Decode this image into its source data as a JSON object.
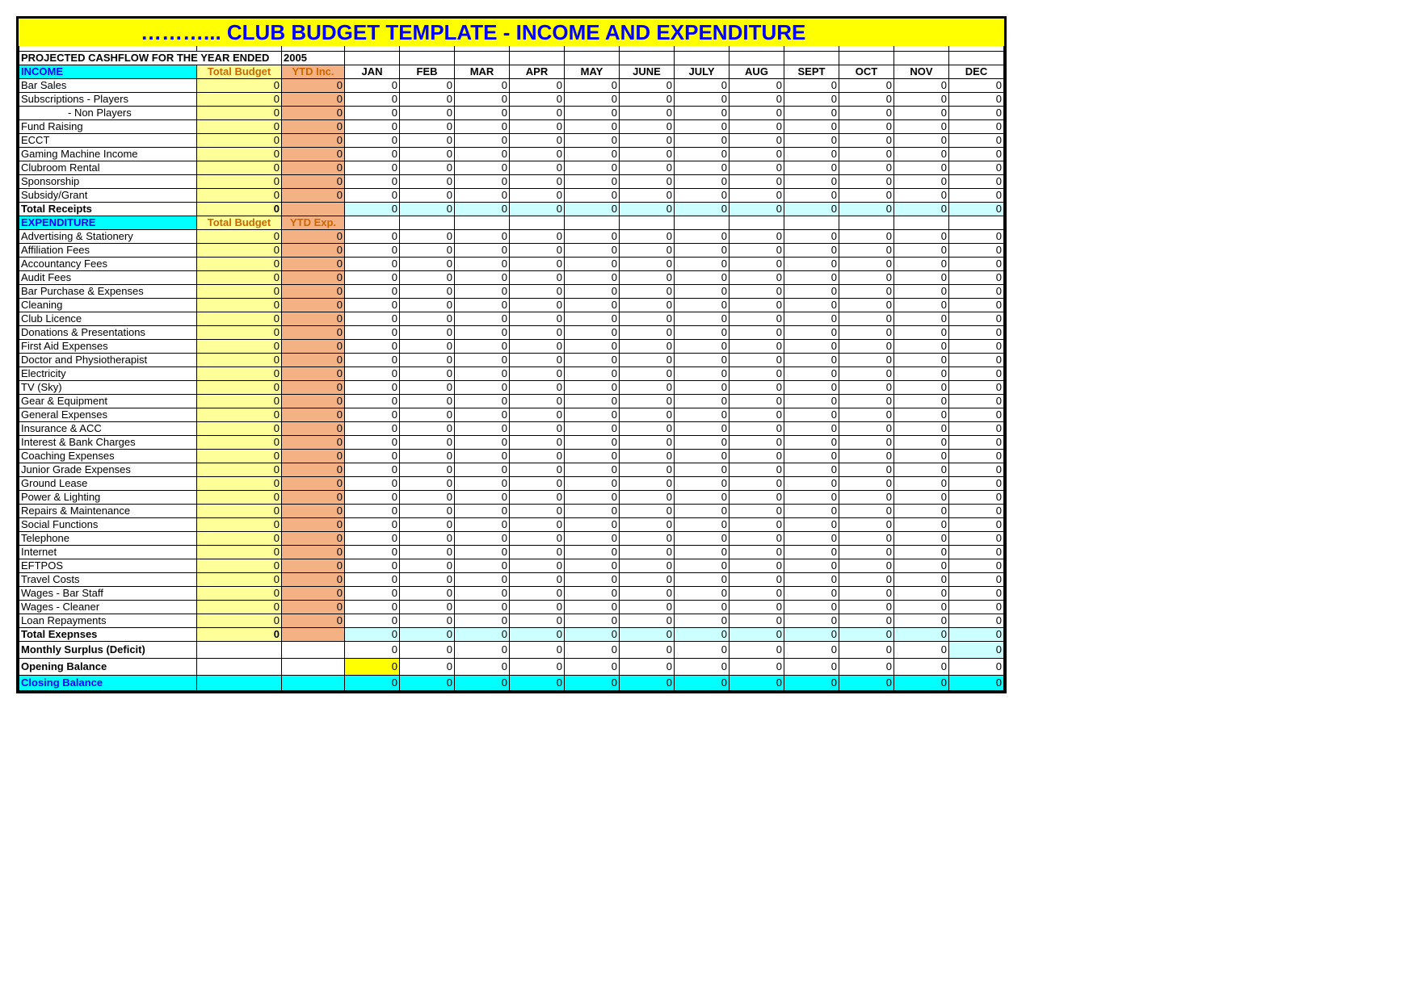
{
  "title": "………...  CLUB BUDGET TEMPLATE - INCOME AND EXPENDITURE",
  "projected_label": "PROJECTED CASHFLOW FOR THE YEAR ENDED",
  "projected_year": "2005",
  "months": [
    "JAN",
    "FEB",
    "MAR",
    "APR",
    "MAY",
    "JUNE",
    "JULY",
    "AUG",
    "SEPT",
    "OCT",
    "NOV",
    "DEC"
  ],
  "income": {
    "header": {
      "label": "INCOME",
      "total_budget": "Total Budget",
      "ytd": "YTD Inc."
    },
    "rows": [
      {
        "label": "Bar Sales",
        "tb": "0",
        "ytd": "0",
        "m": [
          "0",
          "0",
          "0",
          "0",
          "0",
          "0",
          "0",
          "0",
          "0",
          "0",
          "0",
          "0"
        ]
      },
      {
        "label": "Subscriptions - Players",
        "tb": "0",
        "ytd": "0",
        "m": [
          "0",
          "0",
          "0",
          "0",
          "0",
          "0",
          "0",
          "0",
          "0",
          "0",
          "0",
          "0"
        ]
      },
      {
        "label": "- Non Players",
        "indent": true,
        "tb": "0",
        "ytd": "0",
        "m": [
          "0",
          "0",
          "0",
          "0",
          "0",
          "0",
          "0",
          "0",
          "0",
          "0",
          "0",
          "0"
        ]
      },
      {
        "label": "Fund Raising",
        "tb": "0",
        "ytd": "0",
        "m": [
          "0",
          "0",
          "0",
          "0",
          "0",
          "0",
          "0",
          "0",
          "0",
          "0",
          "0",
          "0"
        ]
      },
      {
        "label": "ECCT",
        "tb": "0",
        "ytd": "0",
        "m": [
          "0",
          "0",
          "0",
          "0",
          "0",
          "0",
          "0",
          "0",
          "0",
          "0",
          "0",
          "0"
        ]
      },
      {
        "label": "Gaming Machine Income",
        "tb": "0",
        "ytd": "0",
        "m": [
          "0",
          "0",
          "0",
          "0",
          "0",
          "0",
          "0",
          "0",
          "0",
          "0",
          "0",
          "0"
        ]
      },
      {
        "label": "Clubroom Rental",
        "tb": "0",
        "ytd": "0",
        "m": [
          "0",
          "0",
          "0",
          "0",
          "0",
          "0",
          "0",
          "0",
          "0",
          "0",
          "0",
          "0"
        ]
      },
      {
        "label": "Sponsorship",
        "tb": "0",
        "ytd": "0",
        "m": [
          "0",
          "0",
          "0",
          "0",
          "0",
          "0",
          "0",
          "0",
          "0",
          "0",
          "0",
          "0"
        ]
      },
      {
        "label": "Subsidy/Grant",
        "tb": "0",
        "ytd": "0",
        "m": [
          "0",
          "0",
          "0",
          "0",
          "0",
          "0",
          "0",
          "0",
          "0",
          "0",
          "0",
          "0"
        ]
      }
    ],
    "total": {
      "label": "Total Receipts",
      "tb": "0",
      "ytd": "",
      "m": [
        "0",
        "0",
        "0",
        "0",
        "0",
        "0",
        "0",
        "0",
        "0",
        "0",
        "0",
        "0"
      ]
    }
  },
  "expenditure": {
    "header": {
      "label": "EXPENDITURE",
      "total_budget": "Total Budget",
      "ytd": "YTD Exp."
    },
    "rows": [
      {
        "label": "Advertising & Stationery",
        "tb": "0",
        "ytd": "0",
        "m": [
          "0",
          "0",
          "0",
          "0",
          "0",
          "0",
          "0",
          "0",
          "0",
          "0",
          "0",
          "0"
        ]
      },
      {
        "label": "Affiliation Fees",
        "tb": "0",
        "ytd": "0",
        "m": [
          "0",
          "0",
          "0",
          "0",
          "0",
          "0",
          "0",
          "0",
          "0",
          "0",
          "0",
          "0"
        ]
      },
      {
        "label": "Accountancy Fees",
        "tb": "0",
        "ytd": "0",
        "m": [
          "0",
          "0",
          "0",
          "0",
          "0",
          "0",
          "0",
          "0",
          "0",
          "0",
          "0",
          "0"
        ]
      },
      {
        "label": "Audit Fees",
        "tb": "0",
        "ytd": "0",
        "m": [
          "0",
          "0",
          "0",
          "0",
          "0",
          "0",
          "0",
          "0",
          "0",
          "0",
          "0",
          "0"
        ]
      },
      {
        "label": "Bar Purchase & Expenses",
        "tb": "0",
        "ytd": "0",
        "m": [
          "0",
          "0",
          "0",
          "0",
          "0",
          "0",
          "0",
          "0",
          "0",
          "0",
          "0",
          "0"
        ]
      },
      {
        "label": "Cleaning",
        "tb": "0",
        "ytd": "0",
        "m": [
          "0",
          "0",
          "0",
          "0",
          "0",
          "0",
          "0",
          "0",
          "0",
          "0",
          "0",
          "0"
        ]
      },
      {
        "label": "Club Licence",
        "tb": "0",
        "ytd": "0",
        "m": [
          "0",
          "0",
          "0",
          "0",
          "0",
          "0",
          "0",
          "0",
          "0",
          "0",
          "0",
          "0"
        ]
      },
      {
        "label": "Donations & Presentations",
        "tb": "0",
        "ytd": "0",
        "m": [
          "0",
          "0",
          "0",
          "0",
          "0",
          "0",
          "0",
          "0",
          "0",
          "0",
          "0",
          "0"
        ]
      },
      {
        "label": "First Aid Expenses",
        "tb": "0",
        "ytd": "0",
        "m": [
          "0",
          "0",
          "0",
          "0",
          "0",
          "0",
          "0",
          "0",
          "0",
          "0",
          "0",
          "0"
        ]
      },
      {
        "label": "Doctor and Physiotherapist",
        "tb": "0",
        "ytd": "0",
        "m": [
          "0",
          "0",
          "0",
          "0",
          "0",
          "0",
          "0",
          "0",
          "0",
          "0",
          "0",
          "0"
        ]
      },
      {
        "label": "Electricity",
        "tb": "0",
        "ytd": "0",
        "m": [
          "0",
          "0",
          "0",
          "0",
          "0",
          "0",
          "0",
          "0",
          "0",
          "0",
          "0",
          "0"
        ]
      },
      {
        "label": "TV (Sky)",
        "tb": "0",
        "ytd": "0",
        "m": [
          "0",
          "0",
          "0",
          "0",
          "0",
          "0",
          "0",
          "0",
          "0",
          "0",
          "0",
          "0"
        ]
      },
      {
        "label": "Gear & Equipment",
        "tb": "0",
        "ytd": "0",
        "m": [
          "0",
          "0",
          "0",
          "0",
          "0",
          "0",
          "0",
          "0",
          "0",
          "0",
          "0",
          "0"
        ]
      },
      {
        "label": "General Expenses",
        "tb": "0",
        "ytd": "0",
        "m": [
          "0",
          "0",
          "0",
          "0",
          "0",
          "0",
          "0",
          "0",
          "0",
          "0",
          "0",
          "0"
        ]
      },
      {
        "label": "Insurance & ACC",
        "tb": "0",
        "ytd": "0",
        "m": [
          "0",
          "0",
          "0",
          "0",
          "0",
          "0",
          "0",
          "0",
          "0",
          "0",
          "0",
          "0"
        ]
      },
      {
        "label": "Interest & Bank Charges",
        "tb": "0",
        "ytd": "0",
        "m": [
          "0",
          "0",
          "0",
          "0",
          "0",
          "0",
          "0",
          "0",
          "0",
          "0",
          "0",
          "0"
        ]
      },
      {
        "label": "Coaching Expenses",
        "tb": "0",
        "ytd": "0",
        "m": [
          "0",
          "0",
          "0",
          "0",
          "0",
          "0",
          "0",
          "0",
          "0",
          "0",
          "0",
          "0"
        ]
      },
      {
        "label": "Junior Grade Expenses",
        "tb": "0",
        "ytd": "0",
        "m": [
          "0",
          "0",
          "0",
          "0",
          "0",
          "0",
          "0",
          "0",
          "0",
          "0",
          "0",
          "0"
        ]
      },
      {
        "label": "Ground Lease",
        "tb": "0",
        "ytd": "0",
        "m": [
          "0",
          "0",
          "0",
          "0",
          "0",
          "0",
          "0",
          "0",
          "0",
          "0",
          "0",
          "0"
        ]
      },
      {
        "label": "Power & Lighting",
        "tb": "0",
        "ytd": "0",
        "m": [
          "0",
          "0",
          "0",
          "0",
          "0",
          "0",
          "0",
          "0",
          "0",
          "0",
          "0",
          "0"
        ]
      },
      {
        "label": "Repairs & Maintenance",
        "tb": "0",
        "ytd": "0",
        "m": [
          "0",
          "0",
          "0",
          "0",
          "0",
          "0",
          "0",
          "0",
          "0",
          "0",
          "0",
          "0"
        ]
      },
      {
        "label": "Social Functions",
        "tb": "0",
        "ytd": "0",
        "m": [
          "0",
          "0",
          "0",
          "0",
          "0",
          "0",
          "0",
          "0",
          "0",
          "0",
          "0",
          "0"
        ]
      },
      {
        "label": "Telephone",
        "tb": "0",
        "ytd": "0",
        "m": [
          "0",
          "0",
          "0",
          "0",
          "0",
          "0",
          "0",
          "0",
          "0",
          "0",
          "0",
          "0"
        ]
      },
      {
        "label": "Internet",
        "tb": "0",
        "ytd": "0",
        "m": [
          "0",
          "0",
          "0",
          "0",
          "0",
          "0",
          "0",
          "0",
          "0",
          "0",
          "0",
          "0"
        ]
      },
      {
        "label": "EFTPOS",
        "tb": "0",
        "ytd": "0",
        "m": [
          "0",
          "0",
          "0",
          "0",
          "0",
          "0",
          "0",
          "0",
          "0",
          "0",
          "0",
          "0"
        ]
      },
      {
        "label": "Travel Costs",
        "tb": "0",
        "ytd": "0",
        "m": [
          "0",
          "0",
          "0",
          "0",
          "0",
          "0",
          "0",
          "0",
          "0",
          "0",
          "0",
          "0"
        ]
      },
      {
        "label": "Wages - Bar Staff",
        "tb": "0",
        "ytd": "0",
        "m": [
          "0",
          "0",
          "0",
          "0",
          "0",
          "0",
          "0",
          "0",
          "0",
          "0",
          "0",
          "0"
        ]
      },
      {
        "label": "Wages - Cleaner",
        "tb": "0",
        "ytd": "0",
        "m": [
          "0",
          "0",
          "0",
          "0",
          "0",
          "0",
          "0",
          "0",
          "0",
          "0",
          "0",
          "0"
        ]
      },
      {
        "label": "Loan Repayments",
        "tb": "0",
        "ytd": "0",
        "m": [
          "0",
          "0",
          "0",
          "0",
          "0",
          "0",
          "0",
          "0",
          "0",
          "0",
          "0",
          "0"
        ]
      }
    ],
    "total": {
      "label": "Total  Exepnses",
      "tb": "0",
      "ytd": "",
      "m": [
        "0",
        "0",
        "0",
        "0",
        "0",
        "0",
        "0",
        "0",
        "0",
        "0",
        "0",
        "0"
      ]
    }
  },
  "surplus": {
    "label": "Monthly Surplus (Deficit)",
    "m": [
      "0",
      "0",
      "0",
      "0",
      "0",
      "0",
      "0",
      "0",
      "0",
      "0",
      "0",
      "0"
    ]
  },
  "opening": {
    "label": "Opening Balance",
    "m": [
      "0",
      "0",
      "0",
      "0",
      "0",
      "0",
      "0",
      "0",
      "0",
      "0",
      "0",
      "0"
    ]
  },
  "closing": {
    "label": "Closing Balance",
    "m": [
      "0",
      "0",
      "0",
      "0",
      "0",
      "0",
      "0",
      "0",
      "0",
      "0",
      "0",
      "0"
    ]
  }
}
